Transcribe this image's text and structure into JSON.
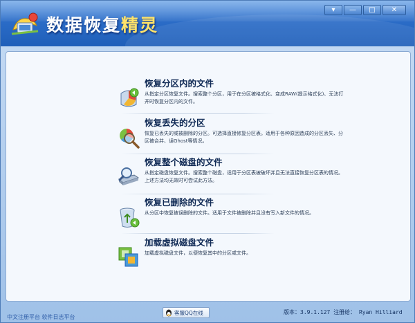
{
  "app": {
    "title_main": "数据恢复",
    "title_accent": "精灵"
  },
  "window_controls": {
    "menu": "▾",
    "minimize": "—",
    "restore": "□",
    "close": "✕"
  },
  "options": [
    {
      "title": "恢复分区内的文件",
      "desc": "从指定分区恢复文件。搜索整个分区，用于在分区被格式化、变成RAW(提示格式化)、无法打开时恢复分区内的文件。",
      "icon": "partition-files-icon"
    },
    {
      "title": "恢复丢失的分区",
      "desc": "恢复已丢失的或被删除的分区。可选择直接修复分区表。适用于各种原因造成的分区丢失、分区被合并、误Ghost等情况。",
      "icon": "lost-partition-icon"
    },
    {
      "title": "恢复整个磁盘的文件",
      "desc": "从指定磁盘恢复文件。搜索整个磁盘，适用于分区表被破坏并且无法直接恢复分区表的情况。上述方法均无效时可尝试此方法。",
      "icon": "disk-files-icon"
    },
    {
      "title": "恢复已删除的文件",
      "desc": "从分区中恢复被误删除的文件。适用于文件被删除并且没有写入新文件的情况。",
      "icon": "recycle-bin-icon"
    },
    {
      "title": "加载虚拟磁盘文件",
      "desc": "加载虚拟磁盘文件，以便恢复其中的分区或文件。",
      "icon": "virtual-disk-icon"
    }
  ],
  "status": {
    "qq_label": "客服QQ在线",
    "version_text": "版本：3.9.1.127 注册给： Ryan Hilliard",
    "left_links": "中文注册平台   软件日志平台"
  },
  "colors": {
    "titlebar": "#2b6cc7",
    "title_accent": "#ffe36a",
    "panel_bg": "#f4f8fd",
    "option_title": "#102a55"
  }
}
